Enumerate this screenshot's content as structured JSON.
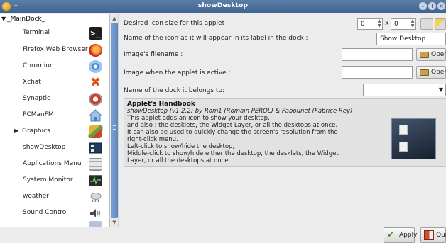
{
  "window": {
    "title": "showDesktop",
    "menu_dash": "–"
  },
  "sidebar": {
    "root_label": "_MainDock_",
    "items": [
      {
        "label": "Terminal",
        "icon": "terminal-icon"
      },
      {
        "label": "Firefox Web Browser",
        "icon": "firefox-icon"
      },
      {
        "label": "Chromium",
        "icon": "chromium-icon"
      },
      {
        "label": "Xchat",
        "icon": "xchat-icon"
      },
      {
        "label": "Synaptic",
        "icon": "synaptic-icon"
      },
      {
        "label": "PCManFM",
        "icon": "home-folder-icon"
      },
      {
        "label": "Graphics",
        "icon": "graphics-icon",
        "expandable": true
      },
      {
        "label": "showDesktop",
        "icon": "show-desktop-icon"
      },
      {
        "label": "Applications Menu",
        "icon": "applications-menu-icon"
      },
      {
        "label": "System Monitor",
        "icon": "system-monitor-icon"
      },
      {
        "label": "weather",
        "icon": "weather-icon"
      },
      {
        "label": "Sound Control",
        "icon": "speaker-icon"
      }
    ]
  },
  "form": {
    "icon_size_label": "Desired icon size for this applet",
    "icon_width": "0",
    "times": "x",
    "icon_height": "0",
    "dock_label_label": "Name of the icon as it will appear in its label in the dock :",
    "dock_label_value": "Show Desktop",
    "image_filename_label": "Image's filename :",
    "image_filename_value": "",
    "image_active_label": "Image when the applet is active :",
    "image_active_value": "",
    "dock_belongs_label": "Name of the dock it belongs to:",
    "dock_belongs_value": "",
    "open_label": "Open"
  },
  "handbook": {
    "title": "Applet's Handbook",
    "subtitle": "showDesktop (v1.2.2) by Rom1 (Romain PEROL) & Fabounet (Fabrice Rey)",
    "lines": [
      "This applet adds an icon to show your desktop,",
      " and also : the desklets, the Widget Layer, or all the desktops at once.",
      "It can also be used to quickly change the screen's resolution from the",
      "right-click menu.",
      "Left-click to show/hide the desktop,",
      "Middle-click to show/hide either the desktop, the desklets, the Widget",
      "Layer, or all the desktops at once."
    ]
  },
  "actions": {
    "apply": "Apply",
    "quit": "Quit"
  },
  "colors": {
    "titlebar": "#4a6f9a",
    "scroll_thumb": "#6f96c9"
  }
}
